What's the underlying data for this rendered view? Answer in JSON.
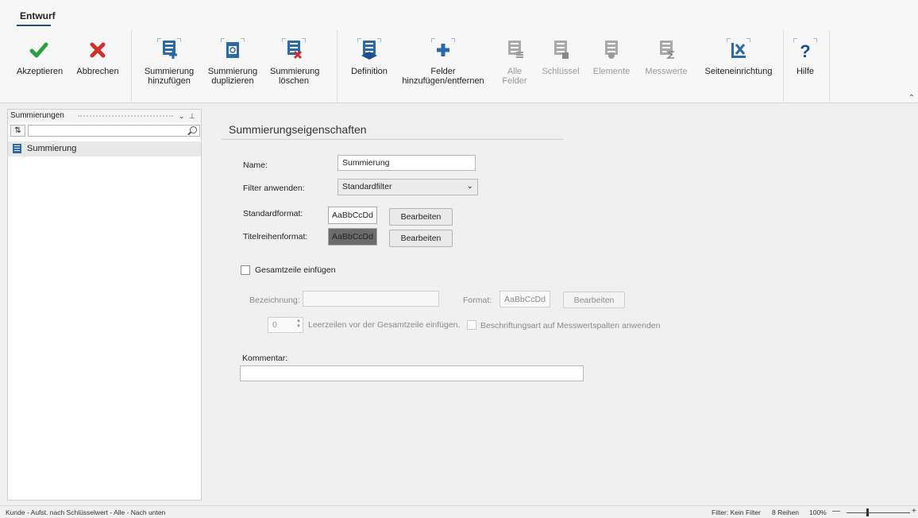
{
  "ribbon": {
    "active_tab": "Entwurf",
    "buttons": {
      "accept": "Akzeptieren",
      "cancel": "Abbrechen",
      "add_summary": [
        "Summierung",
        "hinzufügen"
      ],
      "dup_summary": [
        "Summierung",
        "duplizieren"
      ],
      "del_summary": [
        "Summierung",
        "löschen"
      ],
      "definition": "Definition",
      "fields": [
        "Felder",
        "hinzufügen/entfernen"
      ],
      "all_fields": [
        "Alle",
        "Felder"
      ],
      "key": "Schlüssel",
      "elements": "Elemente",
      "measures": "Messwerte",
      "page_setup": "Seiteneinrichtung",
      "help": "Hilfe"
    }
  },
  "left_panel": {
    "title": "Summierungen",
    "sort_label": "⇅",
    "search_value": "",
    "items": [
      "Summierung"
    ]
  },
  "form": {
    "section_title": "Summierungseigenschaften",
    "name_label": "Name:",
    "name_value": "Summierung",
    "filter_label": "Filter anwenden:",
    "filter_value": "Standardfilter",
    "std_format_label": "Standardformat:",
    "title_format_label": "Titelreihenformat:",
    "swatch_text": "AaBbCcDd",
    "edit_label": "Bearbeiten",
    "total_checkbox_label": "Gesamtzeile einfügen",
    "designation_label": "Bezeichnung:",
    "designation_value": "",
    "format_label": "Format:",
    "spin_value": "0",
    "blank_rows_label": "Leerzeilen vor der Gesamtzeile einfügen.",
    "label_type_label": "Beschriftungsart auf Messwertspalten anwenden",
    "comment_label": "Kommentar:",
    "comment_value": ""
  },
  "status": {
    "left": "Kunde - Aufst. nach Schlüsselwert - Alle - Nach unten",
    "filter": "Filter: Kein Filter",
    "rows": "8 Reihen",
    "zoom": "100%",
    "minus": "—",
    "plus": "+"
  },
  "colors": {
    "accent": "#1c4f8e",
    "accept": "#2ea043",
    "cancel": "#d32f2f",
    "icon_blue": "#2a6aa8"
  }
}
